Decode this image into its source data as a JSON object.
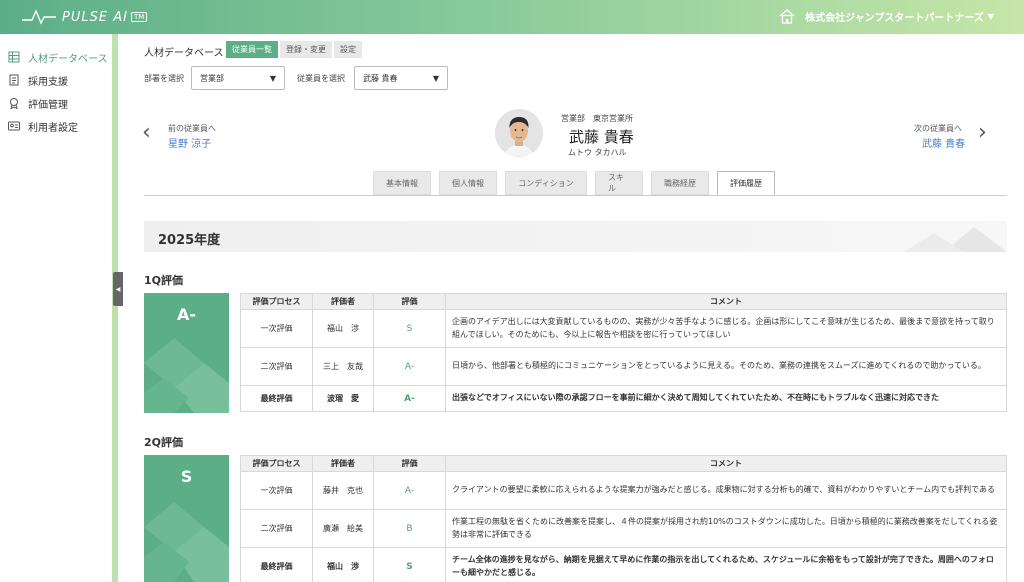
{
  "header": {
    "logo_text": "PULSE AI",
    "logo_tm": "TM",
    "company": "株式会社ジャンプスタートパートナーズ",
    "caret": "▼"
  },
  "sidebar": {
    "items": [
      {
        "label": "人材データベース",
        "icon": "database-icon",
        "active": true
      },
      {
        "label": "採用支援",
        "icon": "document-icon"
      },
      {
        "label": "評価管理",
        "icon": "badge-icon"
      },
      {
        "label": "利用者設定",
        "icon": "user-settings-icon"
      }
    ],
    "collapse_glyph": "◀"
  },
  "breadcrumb": {
    "title": "人材データベース",
    "tabs": [
      "従業員一覧",
      "登録・変更",
      "設定"
    ]
  },
  "filters": {
    "dept_label": "部署を選択",
    "dept_value": "営業部",
    "emp_label": "従業員を選択",
    "emp_value": "武藤 貴春",
    "tri": "▼"
  },
  "employee": {
    "prev_label": "前の従業員へ",
    "prev_name": "星野 涼子",
    "next_label": "次の従業員へ",
    "next_name": "武藤 貴春",
    "dept": "営業部　東京営業所",
    "name": "武藤 貴春",
    "kana": "ムトウ タカハル",
    "prev_arrow": "‹",
    "next_arrow": "›"
  },
  "tabs": [
    "基本情報",
    "個人情報",
    "コンディション",
    "スキル",
    "職務経歴",
    "評価履歴"
  ],
  "year": "2025年度",
  "table_headers": [
    "評価プロセス",
    "評価者",
    "評価",
    "コメント"
  ],
  "quarters": [
    {
      "title": "1Q評価",
      "grade": "A-",
      "rows": [
        {
          "process": "一次評価",
          "evaluator": "福山　渉",
          "grade": "S",
          "comment": "企画のアイデア出しには大変貢献しているものの、実務が少々苦手なように感じる。企画は形にしてこそ意味が生じるため、最後まで意欲を持って取り組んでほしい。そのためにも、今以上に報告や相談を密に行っていってほしい"
        },
        {
          "process": "二次評価",
          "evaluator": "三上　友哉",
          "grade": "A-",
          "comment": "日頃から、他部署とも積極的にコミュニケーションをとっているように見える。そのため、業務の連携をスムーズに進めてくれるので助かっている。"
        },
        {
          "process": "最終評価",
          "evaluator": "波瑠　愛",
          "grade": "A-",
          "comment": "出張などでオフィスにいない際の承認フローを事前に細かく決めて周知してくれていたため、不在時にもトラブルなく迅速に対応できた"
        }
      ]
    },
    {
      "title": "2Q評価",
      "grade": "S",
      "rows": [
        {
          "process": "一次評価",
          "evaluator": "藤井　克也",
          "grade": "A-",
          "comment": "クライアントの要望に柔軟に応えられるような提案力が強みだと感じる。成果物に対する分析も的確で、資料がわかりやすいとチーム内でも評判である"
        },
        {
          "process": "二次評価",
          "evaluator": "廣瀬　絵美",
          "grade": "B",
          "comment": "作業工程の無駄を省くために改善案を提案し、４件の提案が採用され約10%のコストダウンに成功した。日頃から積極的に業務改善案をだしてくれる姿勢は非常に評価できる"
        },
        {
          "process": "最終評価",
          "evaluator": "福山　渉",
          "grade": "S",
          "comment": "チーム全体の進捗を見ながら、納期を見据えて早めに作業の指示を出してくれるため、スケジュールに余裕をもって設計が完了できた。周囲へのフォローも細やかだと感じる。"
        }
      ]
    }
  ],
  "colors": {
    "accent": "#5cae87",
    "link": "#4a7fc9",
    "sidebar_rail": "#bfe1b0"
  }
}
